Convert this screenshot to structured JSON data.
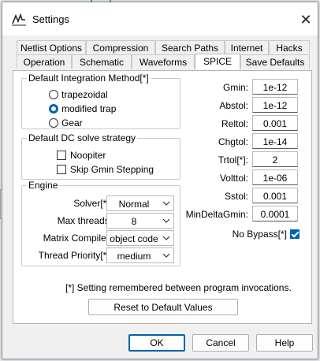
{
  "window": {
    "title": "Settings",
    "close_glyph": "✕"
  },
  "tabs_row1": [
    "Netlist Options",
    "Compression",
    "Search Paths",
    "Internet",
    "Hacks"
  ],
  "tabs_row2": [
    "Operation",
    "Schematic",
    "Waveforms",
    "SPICE",
    "Save Defaults"
  ],
  "active_tab": "SPICE",
  "integration": {
    "legend": "Default Integration Method[*]",
    "options": [
      "trapezoidal",
      "modified trap",
      "Gear"
    ],
    "selected": "modified trap"
  },
  "dc_strategy": {
    "legend": "Default DC solve strategy",
    "noopiter": {
      "label": "Noopiter",
      "checked": false
    },
    "skip_gmin": {
      "label": "Skip Gmin Stepping",
      "checked": false
    }
  },
  "engine": {
    "legend": "Engine",
    "solver": {
      "label": "Solver[*]:",
      "value": "Normal"
    },
    "threads": {
      "label": "Max threads:",
      "value": "8"
    },
    "compiler": {
      "label": "Matrix Compiler:",
      "value": "object code"
    },
    "priority": {
      "label": "Thread Priority[*]:",
      "value": "medium"
    }
  },
  "params": [
    {
      "label": "Gmin:",
      "value": "1e-12"
    },
    {
      "label": "Abstol:",
      "value": "1e-12"
    },
    {
      "label": "Reltol:",
      "value": "0.001"
    },
    {
      "label": "Chgtol:",
      "value": "1e-14"
    },
    {
      "label": "Trtol[*]:",
      "value": "2"
    },
    {
      "label": "Volttol:",
      "value": "1e-06"
    },
    {
      "label": "Sstol:",
      "value": "0.001"
    },
    {
      "label": "MinDeltaGmin:",
      "value": "0.0001"
    }
  ],
  "no_bypass": {
    "label": "No Bypass[*]",
    "checked": true
  },
  "note": "[*] Setting remembered between program invocations.",
  "buttons": {
    "reset": "Reset to Default Values",
    "ok": "OK",
    "cancel": "Cancel",
    "help": "Help"
  },
  "background": {
    "side_label": "s"
  },
  "colors": {
    "accent": "#0063b1",
    "trace_green": "#22c322"
  }
}
